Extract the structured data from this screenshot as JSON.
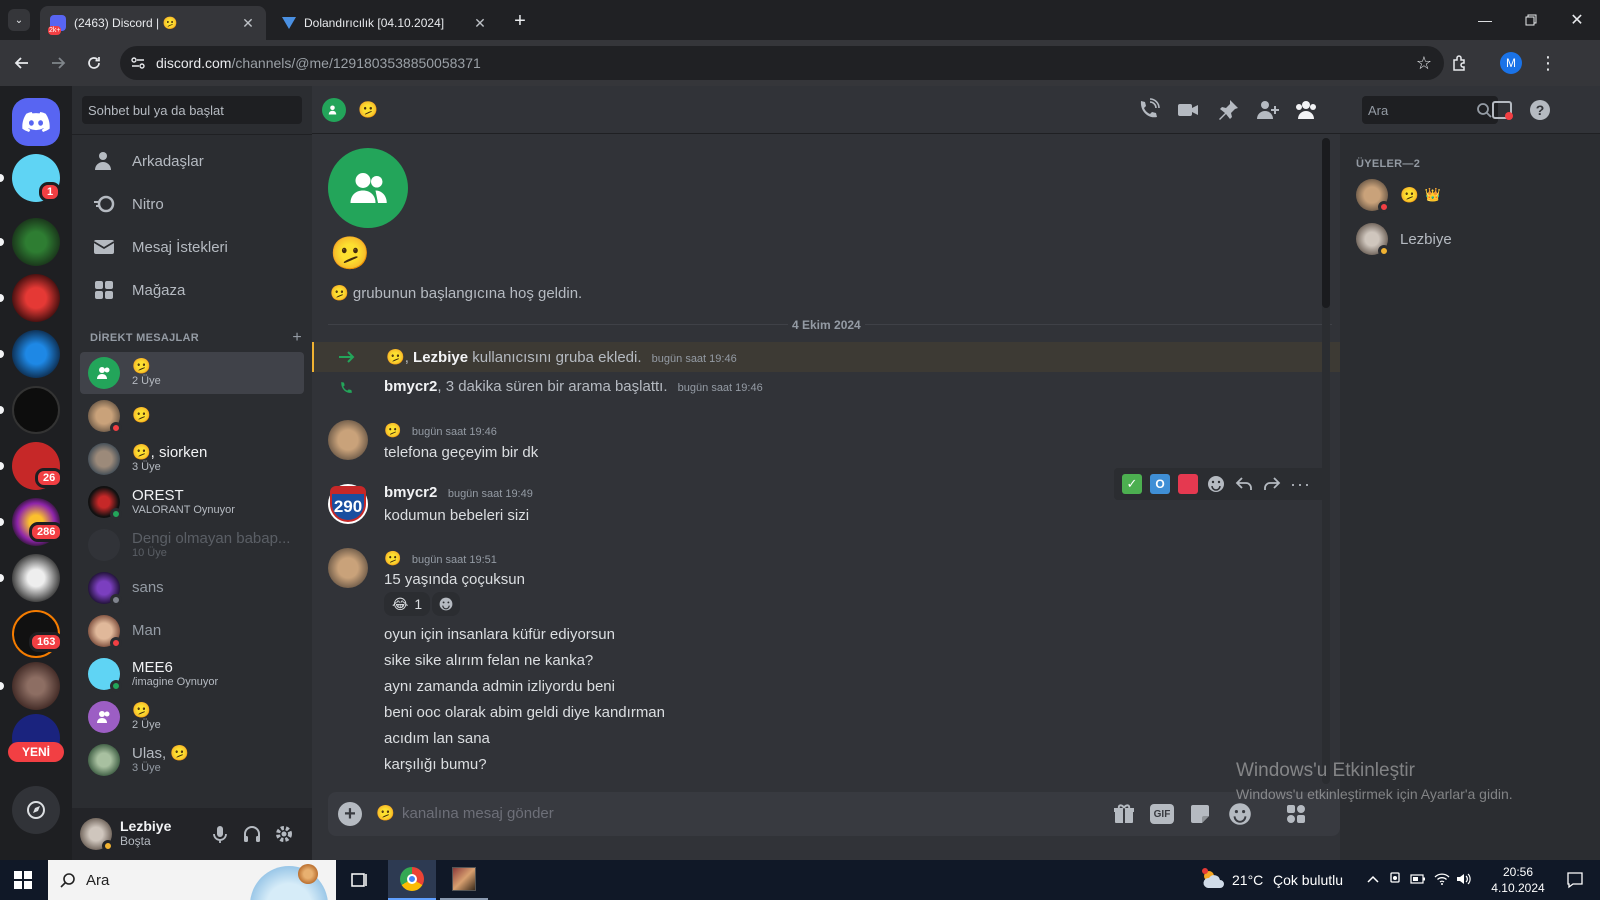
{
  "browser": {
    "tabs": [
      {
        "title": "(2463) Discord | 🫤",
        "favicon_badge": "2k+"
      },
      {
        "title": "Dolandırıcılık [04.10.2024]"
      }
    ],
    "url_host": "discord.com",
    "url_path": "/channels/@me/1291803538850058371",
    "profile_initial": "M"
  },
  "guilds": {
    "badges": [
      "1",
      "26",
      "286",
      "163"
    ],
    "new_label": "YENİ"
  },
  "sidebar": {
    "search_placeholder": "Sohbet bul ya da başlat",
    "nav": [
      "Arkadaşlar",
      "Nitro",
      "Mesaj İstekleri",
      "Mağaza"
    ],
    "dm_header": "DİREKT MESAJLAR",
    "dm_add": "+",
    "dms": [
      {
        "name": "🫤",
        "sub": "2 Üye"
      },
      {
        "name": "🫤",
        "sub": ""
      },
      {
        "name": "🫤, siorken",
        "sub": "3 Üye"
      },
      {
        "name": "OREST",
        "sub": "VALORANT Oynuyor"
      },
      {
        "name": "Dengi olmayan babap...",
        "sub": "10 Üye"
      },
      {
        "name": "sans",
        "sub": ""
      },
      {
        "name": "Man",
        "sub": ""
      },
      {
        "name": "MEE6",
        "sub": "/imagine Oynuyor"
      },
      {
        "name": "🫤",
        "sub": "2 Üye"
      },
      {
        "name": "Ulas, 🫤",
        "sub": "3 Üye"
      }
    ],
    "user": {
      "name": "Lezbiye",
      "status": "Boşta"
    }
  },
  "header": {
    "channel_emoji": "🫤",
    "search_placeholder": "Ara"
  },
  "chat": {
    "welcome_emoji": "🫤",
    "welcome_text": "grubunun başlangıcına hoş geldin.",
    "date_divider": "4 Ekim 2024",
    "system": [
      {
        "actor": "🫤",
        "target": "Lezbiye",
        "text": "kullanıcısını gruba ekledi.",
        "time": "bugün saat 19:46"
      },
      {
        "actor": "bmycr2",
        "text": ", 3 dakika süren bir arama başlattı.",
        "time": "bugün saat 19:46"
      }
    ],
    "messages": [
      {
        "author": "🫤",
        "time": "bugün saat 19:46",
        "lines": [
          "telefona geçeyim bir dk"
        ]
      },
      {
        "author": "bmycr2",
        "time": "bugün saat 19:49",
        "lines": [
          "kodumun bebeleri sizi"
        ]
      },
      {
        "author": "🫤",
        "time": "bugün saat 19:51",
        "lines": [
          "15 yaşında çoçuksun"
        ],
        "reaction": {
          "emoji": "😂",
          "count": "1"
        }
      },
      {
        "lines": [
          "oyun için insanlara küfür ediyorsun",
          "sike sike alırım felan ne kanka?",
          "aynı zamanda admin izliyordu beni",
          "beni ooc olarak abim geldi diye kandırman",
          "acıdım lan sana",
          "karşılığı bumu?"
        ]
      }
    ],
    "avatar_290": "290",
    "hover_icons": [
      "✅",
      "O",
      "🟥"
    ]
  },
  "composer": {
    "placeholder": "kanalına mesaj gönder",
    "prefix_emoji": "🫤"
  },
  "members": {
    "header": "ÜYELER—2",
    "list": [
      {
        "name": "🫤",
        "crown": "👑"
      },
      {
        "name": "Lezbiye"
      }
    ]
  },
  "watermark": {
    "title": "Windows'u Etkinleştir",
    "sub": "Windows'u etkinleştirmek için Ayarlar'a gidin."
  },
  "taskbar": {
    "search": "Ara",
    "weather_temp": "21°C",
    "weather_text": "Çok bulutlu",
    "time": "20:56",
    "date": "4.10.2024"
  },
  "colors": {
    "blurple": "#5865f2",
    "green": "#23a55a",
    "red": "#f23f43",
    "bg": "#313338"
  }
}
